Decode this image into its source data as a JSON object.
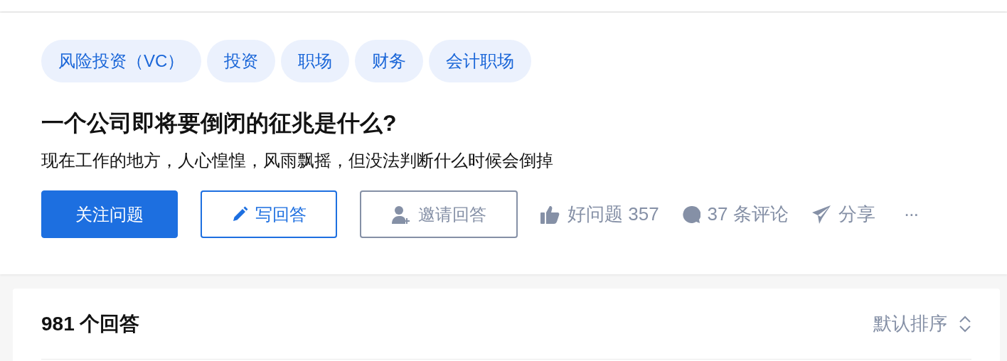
{
  "topics": [
    "风险投资（VC）",
    "投资",
    "职场",
    "财务",
    "会计职场"
  ],
  "question": {
    "title": "一个公司即将要倒闭的征兆是什么?",
    "detail": "现在工作的地方，人心惶惶，风雨飘摇，但没法判断什么时候会倒掉"
  },
  "buttons": [
    {
      "kind": "primary",
      "label": "关注问题"
    },
    {
      "kind": "write",
      "label": "写回答"
    },
    {
      "kind": "invite",
      "label": "邀请回答"
    }
  ],
  "actions": [
    {
      "kind": "like",
      "label": "好问题 357"
    },
    {
      "kind": "comment",
      "label": "37 条评论"
    },
    {
      "kind": "share",
      "label": "分享"
    },
    {
      "kind": "more",
      "label": "···"
    }
  ],
  "answers": {
    "count": "981 个回答",
    "sort": "默认排序"
  }
}
